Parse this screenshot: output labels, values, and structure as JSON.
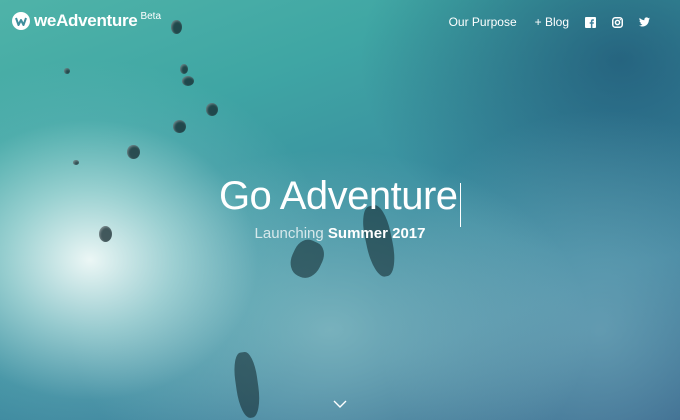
{
  "brand": {
    "name": "weAdventure",
    "badge": "Beta"
  },
  "nav": {
    "items": [
      "Our Purpose",
      "+ Blog"
    ],
    "social": [
      "facebook-icon",
      "instagram-icon",
      "twitter-icon"
    ]
  },
  "hero": {
    "title": "Go Adventure",
    "subtitle_prefix": "Launching",
    "subtitle_highlight": "Summer 2017"
  },
  "scroll": {
    "icon": "chevron-down-icon"
  },
  "colors": {
    "text": "#ffffff",
    "water_dark": "#2f5e86",
    "water_light": "#4fb3a8"
  }
}
